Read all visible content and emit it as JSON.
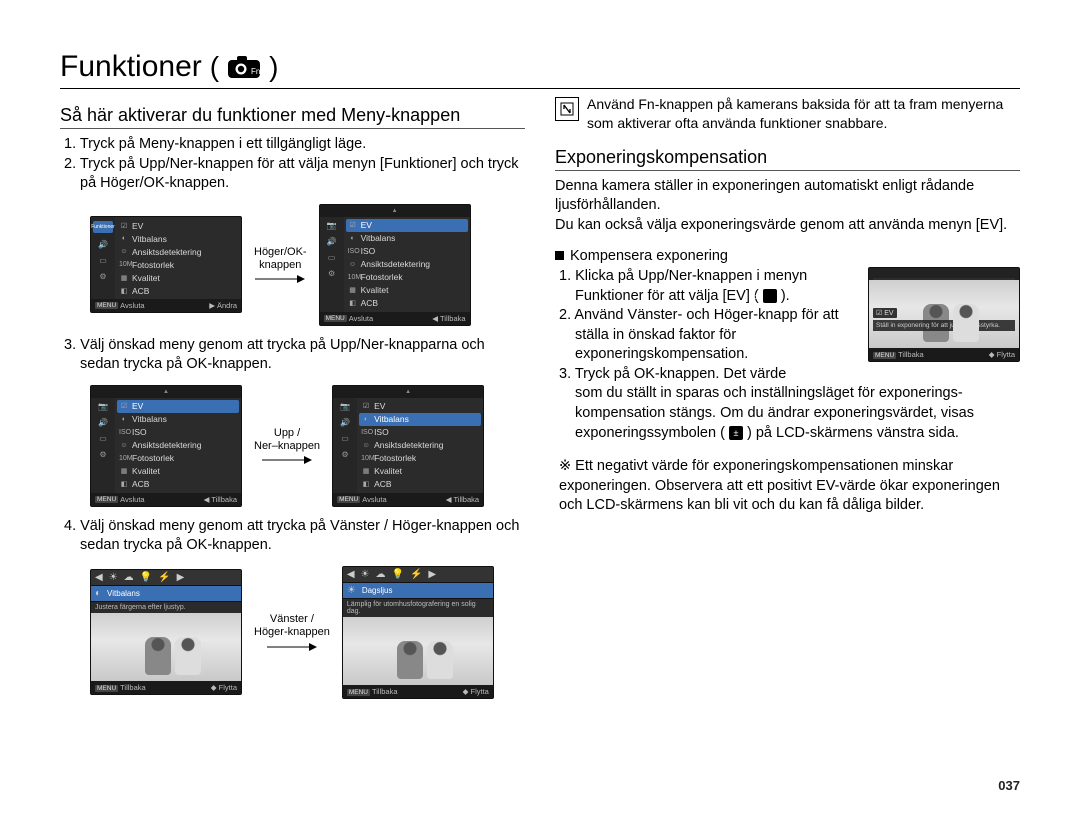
{
  "page_number": "037",
  "title": "Funktioner",
  "title_parens": {
    "open": "(",
    "close": ")"
  },
  "left": {
    "heading": "Så här aktiverar du funktioner med Meny-knappen",
    "steps": [
      "1. Tryck på Meny-knappen i ett tillgängligt läge.",
      "2. Tryck på Upp/Ner-knappen för att välja menyn [Funktioner] och tryck på Höger/OK-knappen.",
      "3. Välj önskad meny genom att trycka på Upp/Ner-knapparna och sedan trycka på OK-knappen.",
      "4. Välj önskad meny genom att trycka på Vänster / Höger-knappen och sedan trycka på OK-knappen."
    ],
    "arrow_labels": [
      "Höger/OK-\nknappen",
      "Upp /\nNer–knappen",
      "Vänster /\nHöger-knappen"
    ]
  },
  "menus": {
    "header_ev": "EV",
    "side_icon": "Fn",
    "rows": [
      "EV",
      "Vitbalans",
      "ISO",
      "Ansiktsdetektering",
      "Fotostorlek",
      "Kvalitet",
      "ACB"
    ],
    "row_icons": [
      "☑",
      "◐",
      "ISO",
      "☺",
      "10M",
      "▦",
      "◧"
    ],
    "side_labels": {
      "funktioner": "Funktioner",
      "ljud": "Ljud",
      "display": "Display",
      "installningar": "Inställningar"
    },
    "bot": {
      "menu": "MENU",
      "avsluta": "Avsluta",
      "andra": "Ändra",
      "tillbaka": "Tillbaka",
      "move": "▶"
    }
  },
  "photo_strip": {
    "label": "Vitbalans",
    "label2": "Dagsljus",
    "hint": "Justera färgerna efter ljustyp.",
    "hint2": "Lämplig för utomhusfotografering en solig dag.",
    "back": "Tillbaka",
    "move": "Flytta",
    "menu": "MENU"
  },
  "right": {
    "callout": "Använd Fn-knappen på kamerans baksida för att ta fram menyerna som aktiverar ofta använda funktioner snabbare.",
    "heading": "Exponeringskompensation",
    "para1": "Denna kamera ställer in exponeringen automatiskt enligt rådande ljusförhållanden.",
    "para2": "Du kan också välja exponeringsvärde genom att använda menyn [EV].",
    "sub": "Kompensera exponering",
    "steps_a": "1. Klicka på Upp/Ner-knappen i menyn Funktioner för att välja [EV] (",
    "steps_a2": ").",
    "steps_b": "2. Använd Vänster- och Höger-knapp för att ställa in önskad faktor för exponeringskompensation.",
    "steps_c1": "3. Tryck på OK-knappen. Det värde",
    "steps_c2": "som du ställt in sparas och inställningsläget för exponerings-kompensation stängs. Om du ändrar exponeringsvärdet, visas exponeringssymbolen (",
    "steps_c3": ") på LCD-skärmens vänstra sida.",
    "note": "※ Ett negativt värde för exponeringskompensationen minskar exponeringen. Observera att ett positivt EV-värde ökar exponeringen och LCD-skärmens kan bli vit och du kan få dåliga bilder.",
    "ev_photo": {
      "ev": "EV",
      "hint": "Ställ in exponering för att justera ljusstyrka.",
      "back": "Tillbaka",
      "move": "Flytta",
      "menu": "MENU"
    }
  }
}
